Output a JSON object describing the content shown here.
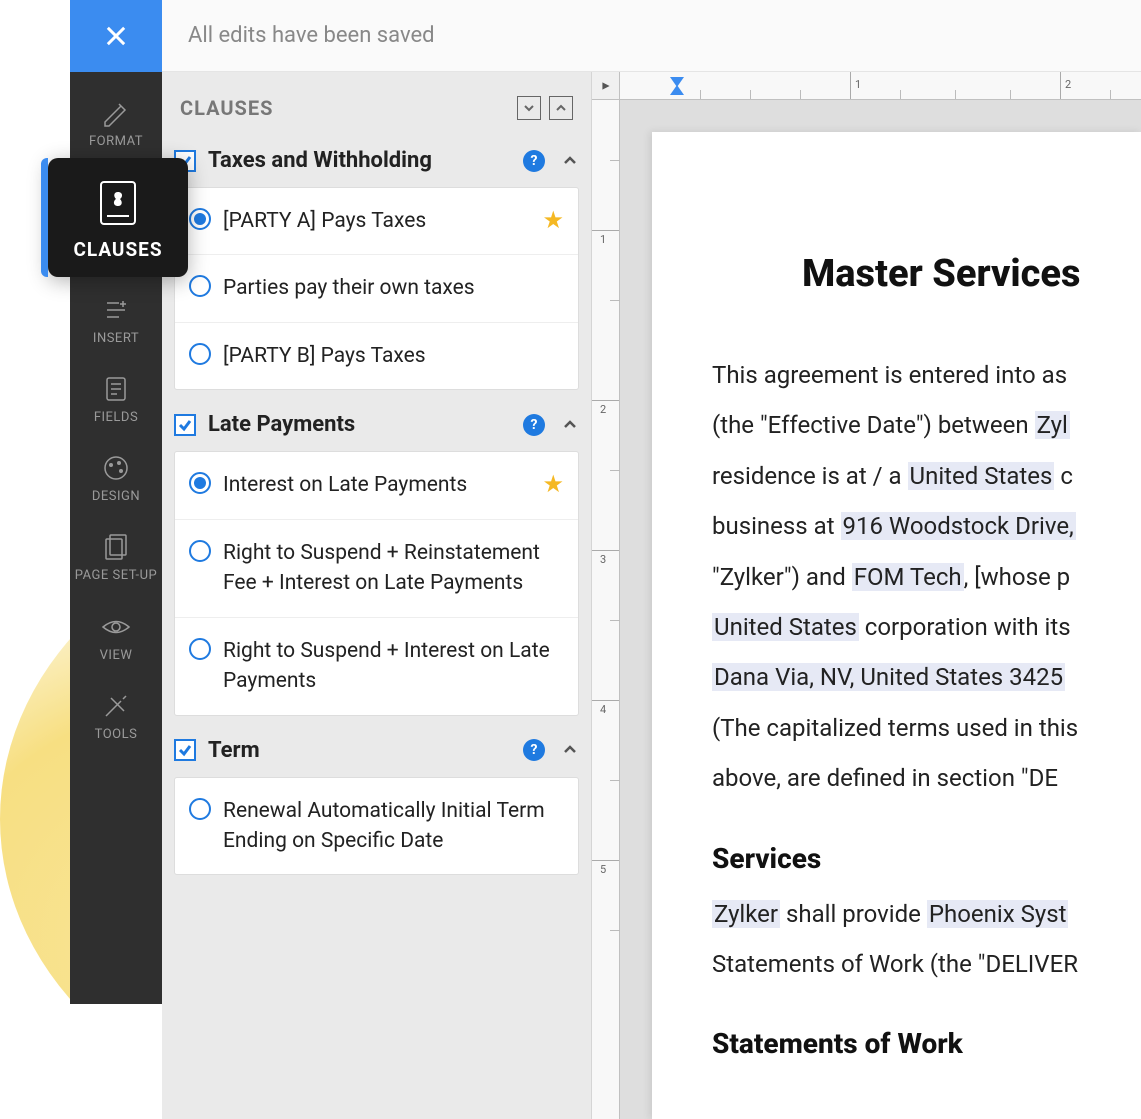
{
  "topbar": {
    "save_status": "All edits have been saved"
  },
  "toolbar": {
    "items": [
      {
        "label": "FORMAT"
      },
      {
        "label": "CLAUSES"
      },
      {
        "label": "INSERT"
      },
      {
        "label": "FIELDS"
      },
      {
        "label": "DESIGN"
      },
      {
        "label": "PAGE SET-UP"
      },
      {
        "label": "VIEW"
      },
      {
        "label": "TOOLS"
      }
    ],
    "active_label": "CLAUSES"
  },
  "panel": {
    "title": "CLAUSES",
    "groups": [
      {
        "title": "Taxes and Withholding",
        "options": [
          {
            "label": "[PARTY A] Pays Taxes",
            "selected": true,
            "starred": true
          },
          {
            "label": "Parties pay their own taxes",
            "selected": false,
            "starred": false
          },
          {
            "label": "[PARTY B] Pays Taxes",
            "selected": false,
            "starred": false
          }
        ]
      },
      {
        "title": "Late Payments",
        "options": [
          {
            "label": "Interest on Late Payments",
            "selected": true,
            "starred": true
          },
          {
            "label": "Right to Suspend + Reinstatement Fee + Interest on Late Payments",
            "selected": false,
            "starred": false
          },
          {
            "label": "Right to Suspend + Interest on Late Payments",
            "selected": false,
            "starred": false
          }
        ]
      },
      {
        "title": "Term",
        "options": [
          {
            "label": "Renewal Automatically Initial Term Ending on Specific Date",
            "selected": false,
            "starred": false
          }
        ]
      }
    ]
  },
  "ruler": {
    "h_labels": [
      "1",
      "2"
    ],
    "v_labels": [
      "1",
      "2",
      "3",
      "4",
      "5"
    ]
  },
  "document": {
    "title": "Master Services",
    "intro_parts": {
      "p1a": "This agreement is entered into as ",
      "p1b": "(the \"Effective Date\") between ",
      "zylker": "Zyl",
      "p2a": "residence is at / a ",
      "us1": "United States",
      "p2b": " c",
      "p3a": "business at ",
      "addr1": "916 Woodstock Drive,",
      "p4a": "\"Zylker\") and ",
      "fom": "FOM Tech",
      "p4b": ", [whose p",
      "us2": "United States",
      "p5a": " corporation with its ",
      "addr2": "Dana Via, NV, United States 3425",
      "p6": "(The capitalized terms used in this",
      "p7": "above, are defined in section \"DE"
    },
    "services_heading": "Services",
    "services_parts": {
      "zylker2": "Zylker",
      "s1": " shall provide ",
      "phoenix": "Phoenix Syst",
      "s2": "Statements of Work (the \"DELIVER"
    },
    "sow_heading": "Statements of Work"
  }
}
